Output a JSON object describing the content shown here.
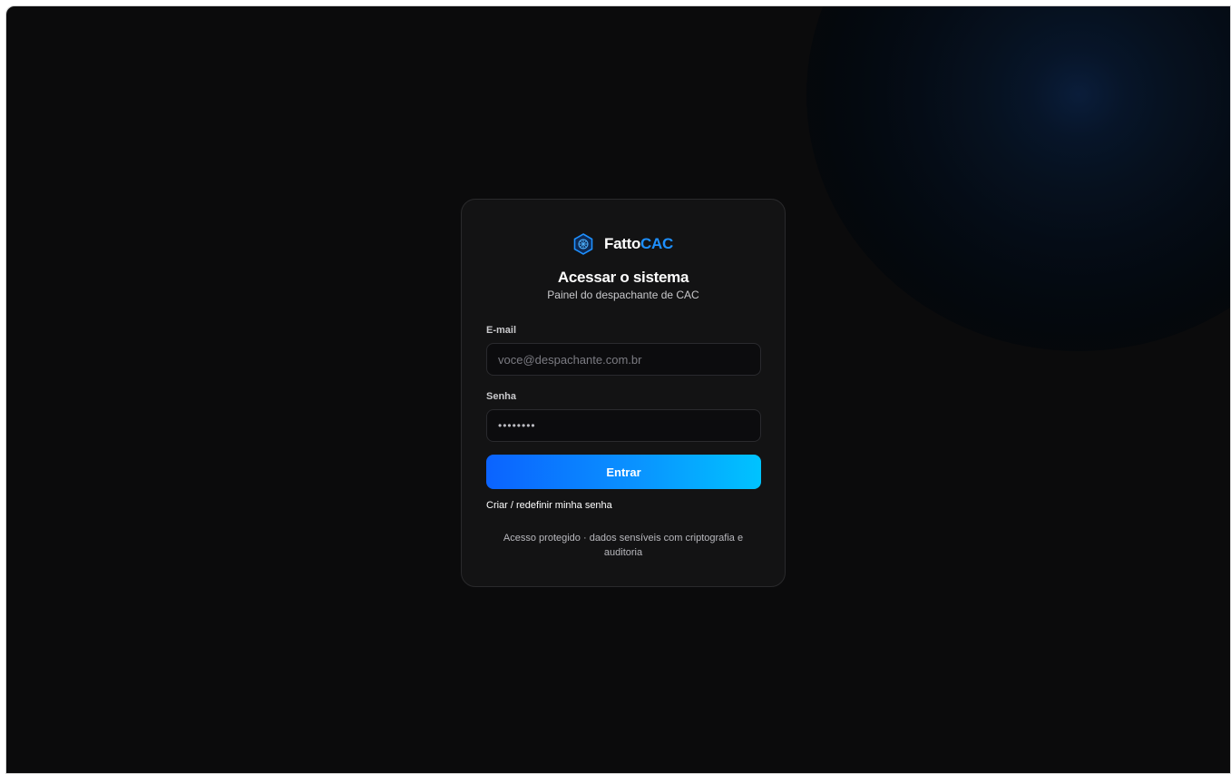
{
  "brand": {
    "name_part1": "Fatto",
    "name_part2": "CAC",
    "icon": "hexagon-grid-icon",
    "accent_color": "#1e90ff"
  },
  "login": {
    "title": "Acessar o sistema",
    "subtitle": "Painel do despachante de CAC",
    "email_label": "E-mail",
    "email_placeholder": "voce@despachante.com.br",
    "password_label": "Senha",
    "password_value": "••••••••",
    "submit_label": "Entrar",
    "reset_link": "Criar / redefinir minha senha",
    "footnote": "Acesso protegido · dados sensíveis com criptografia e auditoria"
  },
  "colors": {
    "background": "#0b0b0c",
    "card": "#131314",
    "button_gradient_start": "#0b63ff",
    "button_gradient_end": "#00c3ff"
  }
}
